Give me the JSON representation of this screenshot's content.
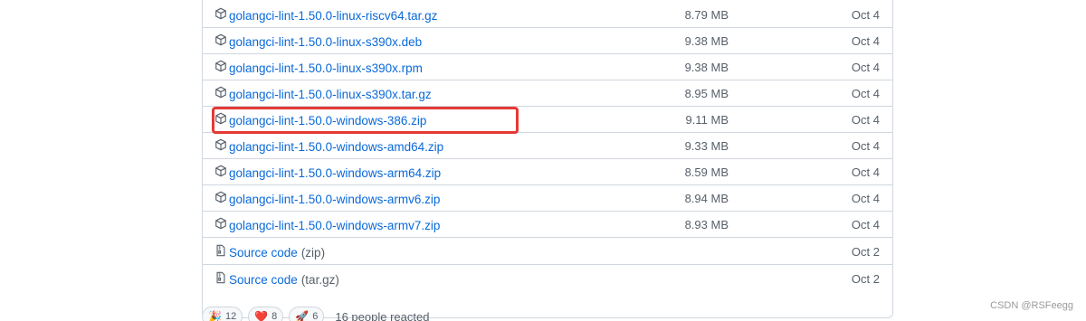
{
  "assets": [
    {
      "name": "golangci-lint-1.50.0-linux-riscv64.tar.gz",
      "size": "8.79 MB",
      "date": "Oct 4",
      "icon": "package-icon"
    },
    {
      "name": "golangci-lint-1.50.0-linux-s390x.deb",
      "size": "9.38 MB",
      "date": "Oct 4",
      "icon": "package-icon"
    },
    {
      "name": "golangci-lint-1.50.0-linux-s390x.rpm",
      "size": "9.38 MB",
      "date": "Oct 4",
      "icon": "package-icon"
    },
    {
      "name": "golangci-lint-1.50.0-linux-s390x.tar.gz",
      "size": "8.95 MB",
      "date": "Oct 4",
      "icon": "package-icon"
    },
    {
      "name": "golangci-lint-1.50.0-windows-386.zip",
      "size": "9.11 MB",
      "date": "Oct 4",
      "icon": "package-icon"
    },
    {
      "name": "golangci-lint-1.50.0-windows-amd64.zip",
      "size": "9.33 MB",
      "date": "Oct 4",
      "icon": "package-icon"
    },
    {
      "name": "golangci-lint-1.50.0-windows-arm64.zip",
      "size": "8.59 MB",
      "date": "Oct 4",
      "icon": "package-icon"
    },
    {
      "name": "golangci-lint-1.50.0-windows-armv6.zip",
      "size": "8.94 MB",
      "date": "Oct 4",
      "icon": "package-icon"
    },
    {
      "name": "golangci-lint-1.50.0-windows-armv7.zip",
      "size": "8.93 MB",
      "date": "Oct 4",
      "icon": "package-icon"
    }
  ],
  "source_code": [
    {
      "label": "Source code",
      "suffix": "(zip)",
      "date": "Oct 2",
      "icon": "file-zip-icon"
    },
    {
      "label": "Source code",
      "suffix": "(tar.gz)",
      "date": "Oct 2",
      "icon": "file-zip-icon"
    }
  ],
  "reactions": {
    "items": [
      {
        "emoji": "🎉",
        "count": "12",
        "icon": "hooray-icon"
      },
      {
        "emoji": "❤️",
        "count": "8",
        "icon": "heart-icon"
      },
      {
        "emoji": "🚀",
        "count": "6",
        "icon": "rocket-icon"
      }
    ],
    "summary": "16 people reacted"
  },
  "watermark": "CSDN @RSFeegg",
  "colors": {
    "link": "#0969da",
    "muted": "#57606a",
    "border": "#d0d7de",
    "highlight": "#e53935"
  }
}
